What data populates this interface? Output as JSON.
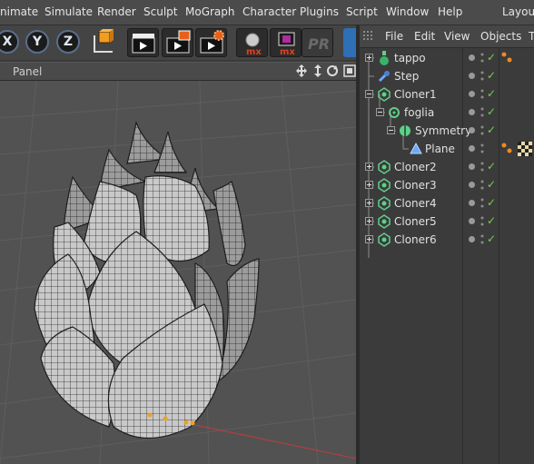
{
  "menubar": {
    "items": [
      "nimate",
      "Simulate",
      "Render",
      "Sculpt",
      "MoGraph",
      "Character",
      "Plugins",
      "Script",
      "Window",
      "Help",
      "Layout"
    ]
  },
  "toolbar": {
    "axis_x": "X",
    "axis_y": "Y",
    "axis_z": "Z"
  },
  "viewport": {
    "panel_label": "Panel"
  },
  "objects_panel": {
    "menu": [
      "File",
      "Edit",
      "View",
      "Objects",
      "T"
    ],
    "objects": [
      {
        "name": "tappo",
        "icon": "bottle-icon"
      },
      {
        "name": "Step",
        "icon": "step-effector-icon"
      },
      {
        "name": "Cloner1",
        "icon": "cloner-icon"
      },
      {
        "name": "foglia",
        "icon": "null-icon"
      },
      {
        "name": "Symmetry",
        "icon": "symmetry-icon"
      },
      {
        "name": "Plane",
        "icon": "plane-icon"
      },
      {
        "name": "Cloner2",
        "icon": "cloner-icon"
      },
      {
        "name": "Cloner3",
        "icon": "cloner-icon"
      },
      {
        "name": "Cloner4",
        "icon": "cloner-icon"
      },
      {
        "name": "Cloner5",
        "icon": "cloner-icon"
      },
      {
        "name": "Cloner6",
        "icon": "cloner-icon"
      }
    ]
  },
  "colors": {
    "accent_check": "#6fd24f",
    "point_orange": "#f0a020",
    "axis_red": "#c83a3a"
  }
}
